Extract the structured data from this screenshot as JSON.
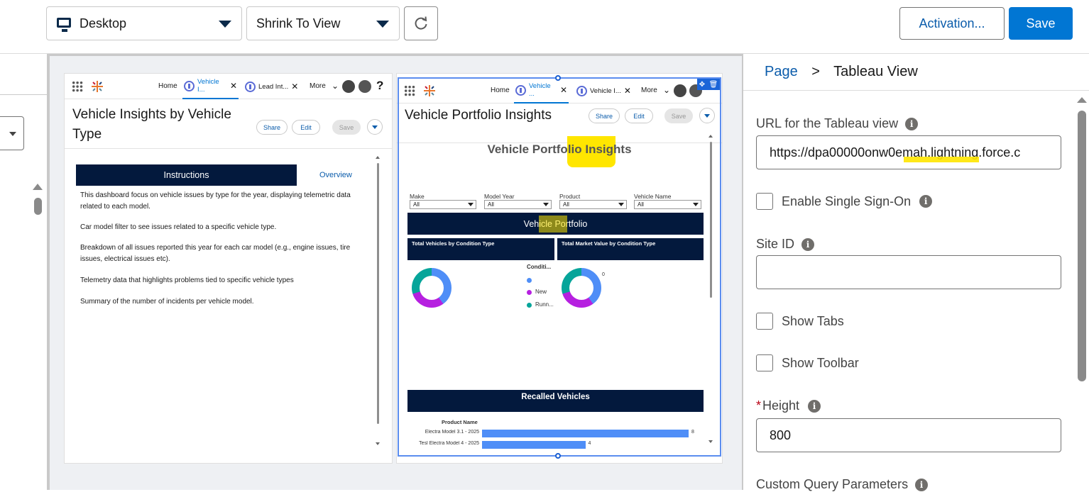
{
  "toolbar": {
    "device_value": "Desktop",
    "shrink_value": "Shrink To View",
    "activation_label": "Activation...",
    "save_label": "Save"
  },
  "left_panel": {
    "nav": {
      "home": "Home",
      "tab1": "Vehicle I...",
      "tab2": "Lead Int...",
      "more": "More",
      "help": "?"
    },
    "title_line1": "Vehicle Insights by Vehicle",
    "title_line2": "Type",
    "share": "Share",
    "edit": "Edit",
    "save": "Save",
    "instructions_header": "Instructions",
    "overview_link": "Overview",
    "paragraphs": [
      "This dashboard focus on vehicle issues by type for the year, displaying telemetric data related to each model.",
      "Car model filter to see issues related to a specific vehicle type.",
      "Breakdown of all issues reported this year for each car model (e.g., engine issues, tire issues, electrical issues etc).",
      "Telemetry data that highlights problems tied to specific vehicle types",
      "Summary of the number of incidents per vehicle model."
    ]
  },
  "right_panel": {
    "nav": {
      "home": "Home",
      "tab1": "Vehicle ...",
      "tab2": "Vehicle I...",
      "more": "More"
    },
    "title": "Vehicle Portfolio Insights",
    "share": "Share",
    "edit": "Edit",
    "save": "Save",
    "dashboard": {
      "title": "Vehicle Portfolio Insights",
      "filters": [
        {
          "label": "Make",
          "value": "All"
        },
        {
          "label": "Model Year",
          "value": "All"
        },
        {
          "label": "Product",
          "value": "All"
        },
        {
          "label": "Vehicle Name",
          "value": "All"
        }
      ],
      "section_title": "Vehicle Portfolio",
      "chart1_title": "Total Vehicles by Condition Type",
      "chart2_title": "Total Market Value by Condition Type",
      "legend_title": "Conditi...",
      "legend_items": [
        "",
        "New",
        "Runn..."
      ],
      "chart2_value_label": "0",
      "recalled_title": "Recalled Vehicles",
      "product_name_header": "Product Name",
      "bars": [
        {
          "label": "Electra Model 3.1 - 2025",
          "value": 8
        },
        {
          "label": "Tesl Electra Model 4 - 2025",
          "value": 4
        }
      ],
      "colors": {
        "blue": "#4f8ef7",
        "purple": "#b620e0",
        "teal": "#06a59a",
        "navy": "#03193d"
      }
    }
  },
  "props": {
    "breadcrumb_page": "Page",
    "breadcrumb_sep": ">",
    "breadcrumb_current": "Tableau View",
    "url_label": "URL for the Tableau view",
    "url_value": "https://dpa00000onw0emah.lightning.force.c",
    "sso_label": "Enable Single Sign-On",
    "site_id_label": "Site ID",
    "site_id_value": "",
    "show_tabs_label": "Show Tabs",
    "show_toolbar_label": "Show Toolbar",
    "height_required": "*",
    "height_label": "Height",
    "height_value": "800",
    "custom_query_label": "Custom Query Parameters"
  },
  "accent": "#0176d3"
}
